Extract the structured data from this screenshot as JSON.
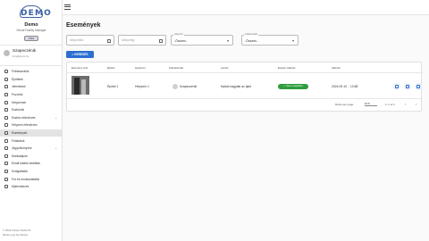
{
  "sidebar": {
    "logo_text": "DEMO",
    "brand": "Demo",
    "role": "Virtual Facility Manager",
    "role_badge": "FM4",
    "user": {
      "name": "Szapeczénik",
      "email": "info@demo.hu"
    },
    "items": [
      {
        "label": "Felhasználók",
        "icon": "users-icon"
      },
      {
        "label": "Épületek",
        "icon": "building-icon"
      },
      {
        "label": "Jelentések",
        "icon": "report-icon"
      },
      {
        "label": "Pozíciók",
        "icon": "pin-icon"
      },
      {
        "label": "Helyszínek",
        "icon": "location-icon"
      },
      {
        "label": "Eszközök",
        "icon": "tool-icon"
      },
      {
        "label": "Eszköz ellenőrzés",
        "icon": "check-icon",
        "expandable": true
      },
      {
        "label": "Helyszín ellenőrzés",
        "icon": "clipboard-icon"
      },
      {
        "label": "Események",
        "icon": "event-icon",
        "active": true
      },
      {
        "label": "Feladatok",
        "icon": "task-icon"
      },
      {
        "label": "Jegyzőkönyvek",
        "icon": "document-icon",
        "expandable": true
      },
      {
        "label": "Munkalapok",
        "icon": "sheet-icon"
      },
      {
        "label": "Email küldés beállítás",
        "icon": "mail-icon"
      },
      {
        "label": "Szolgáltatók",
        "icon": "provider-icon"
      },
      {
        "label": "Fúr és munkavállalók",
        "icon": "people-icon"
      },
      {
        "label": "Kijelentkezés",
        "icon": "logout-icon"
      }
    ],
    "version_line1": "© 2024 Arkane Mobil Kft.",
    "version_line2": "Minden jog fenntartva."
  },
  "page": {
    "title": "Események",
    "filters": {
      "date_from_placeholder": "Időponttól",
      "date_to_placeholder": "Időpontig",
      "select1_label": "Helyszín",
      "select1_value": "-Összes-",
      "select2_label": "Felhasználó",
      "select2_value": "-Összes-",
      "search_button": "KERESÉS"
    },
    "table": {
      "headers": [
        "Esemény fotó",
        "Épület",
        "Helyszín",
        "Felhasználó",
        "Leírás",
        "Esetén státusz",
        "Időpont"
      ],
      "rows": [
        {
          "building": "Épület 1",
          "location": "Helyszín 1",
          "user": "Szapeczénik",
          "description": "Nyitva hagyták az ajtót",
          "status": "Nem megoldott",
          "time": "2024.09.10. - 13:58"
        }
      ],
      "pagination": {
        "rows_per_page_label": "Rows per page:",
        "rows_per_page_value": "10",
        "range": "1–1 of 1"
      }
    }
  },
  "colors": {
    "accent": "#2b6fd1",
    "status_ok": "#2e9d3d"
  }
}
